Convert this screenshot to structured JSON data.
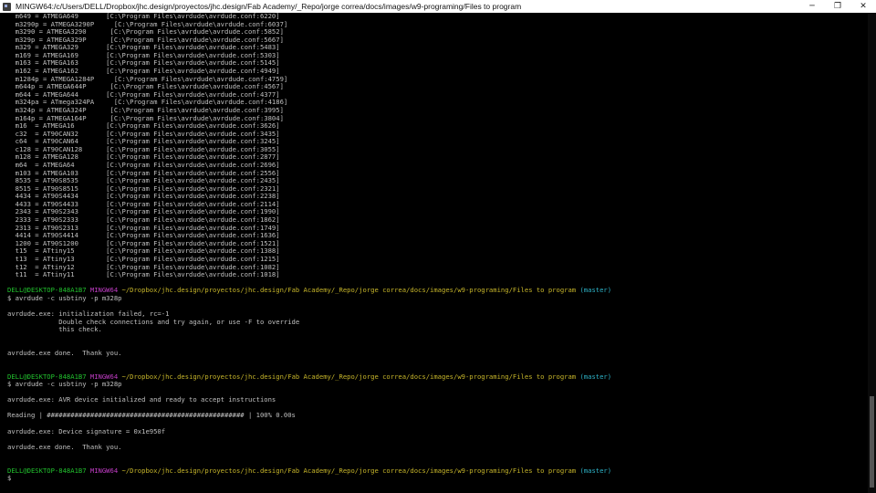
{
  "window": {
    "title": "MINGW64:/c/Users/DELL/Dropbox/jhc.design/proyectos/jhc.design/Fab Academy/_Repo/jorge correa/docs/images/w9-programing/Files to program",
    "controls": {
      "minimize": "─",
      "maximize": "❐",
      "close": "✕"
    }
  },
  "terminal": {
    "device_lines": [
      "  m649 = ATMEGA649       [C:\\Program Files\\avrdude\\avrdude.conf:6220]",
      "  m3290p = ATMEGA3290P     [C:\\Program Files\\avrdude\\avrdude.conf:6037]",
      "  m3290 = ATMEGA3290      [C:\\Program Files\\avrdude\\avrdude.conf:5852]",
      "  m329p = ATMEGA329P      [C:\\Program Files\\avrdude\\avrdude.conf:5667]",
      "  m329 = ATMEGA329       [C:\\Program Files\\avrdude\\avrdude.conf:5483]",
      "  m169 = ATMEGA169       [C:\\Program Files\\avrdude\\avrdude.conf:5303]",
      "  m163 = ATMEGA163       [C:\\Program Files\\avrdude\\avrdude.conf:5145]",
      "  m162 = ATMEGA162       [C:\\Program Files\\avrdude\\avrdude.conf:4949]",
      "  m1284p = ATMEGA1284P     [C:\\Program Files\\avrdude\\avrdude.conf:4759]",
      "  m644p = ATMEGA644P      [C:\\Program Files\\avrdude\\avrdude.conf:4567]",
      "  m644 = ATMEGA644       [C:\\Program Files\\avrdude\\avrdude.conf:4377]",
      "  m324pa = ATmega324PA     [C:\\Program Files\\avrdude\\avrdude.conf:4186]",
      "  m324p = ATMEGA324P      [C:\\Program Files\\avrdude\\avrdude.conf:3995]",
      "  m164p = ATMEGA164P      [C:\\Program Files\\avrdude\\avrdude.conf:3804]",
      "  m16  = ATMEGA16        [C:\\Program Files\\avrdude\\avrdude.conf:3626]",
      "  c32  = AT90CAN32       [C:\\Program Files\\avrdude\\avrdude.conf:3435]",
      "  c64  = AT90CAN64       [C:\\Program Files\\avrdude\\avrdude.conf:3245]",
      "  c128 = AT90CAN128      [C:\\Program Files\\avrdude\\avrdude.conf:3055]",
      "  m128 = ATMEGA128       [C:\\Program Files\\avrdude\\avrdude.conf:2877]",
      "  m64  = ATMEGA64        [C:\\Program Files\\avrdude\\avrdude.conf:2696]",
      "  m103 = ATMEGA103       [C:\\Program Files\\avrdude\\avrdude.conf:2556]",
      "  8535 = AT90S8535       [C:\\Program Files\\avrdude\\avrdude.conf:2435]",
      "  8515 = AT90S8515       [C:\\Program Files\\avrdude\\avrdude.conf:2321]",
      "  4434 = AT90S4434       [C:\\Program Files\\avrdude\\avrdude.conf:2238]",
      "  4433 = AT90S4433       [C:\\Program Files\\avrdude\\avrdude.conf:2114]",
      "  2343 = AT90S2343       [C:\\Program Files\\avrdude\\avrdude.conf:1990]",
      "  2333 = AT90S2333       [C:\\Program Files\\avrdude\\avrdude.conf:1862]",
      "  2313 = AT90S2313       [C:\\Program Files\\avrdude\\avrdude.conf:1749]",
      "  4414 = AT90S4414       [C:\\Program Files\\avrdude\\avrdude.conf:1636]",
      "  1200 = AT90S1200       [C:\\Program Files\\avrdude\\avrdude.conf:1521]",
      "  t15  = ATtiny15        [C:\\Program Files\\avrdude\\avrdude.conf:1388]",
      "  t13  = ATtiny13        [C:\\Program Files\\avrdude\\avrdude.conf:1215]",
      "  t12  = ATtiny12        [C:\\Program Files\\avrdude\\avrdude.conf:1082]",
      "  t11  = ATtiny11        [C:\\Program Files\\avrdude\\avrdude.conf:1018]"
    ],
    "prompt": {
      "user_host": "DELL@DESKTOP-848A1B7",
      "shell": "MINGW64",
      "path": "~/Dropbox/jhc.design/proyectos/jhc.design/Fab Academy/_Repo/jorge correa/docs/images/w9-programing/Files to program",
      "branch": "(master)"
    },
    "session1": {
      "command": "$ avrdude -c usbtiny -p m328p",
      "line1": "avrdude.exe: initialization failed, rc=-1",
      "line2": "             Double check connections and try again, or use -F to override",
      "line3": "             this check.",
      "done": "avrdude.exe done.  Thank you."
    },
    "session2": {
      "command": "$ avrdude -c usbtiny -p m328p",
      "init": "avrdude.exe: AVR device initialized and ready to accept instructions",
      "reading": "Reading | ################################################## | 100% 0.00s",
      "signature": "avrdude.exe: Device signature = 0x1e950f",
      "done": "avrdude.exe done.  Thank you."
    },
    "final_prompt": "$"
  },
  "colors": {
    "background": "#000000",
    "text": "#c0c0c0",
    "user_host": "#22c22e",
    "shell": "#c33ec7",
    "path": "#c6b52a",
    "branch": "#2eb4c9"
  }
}
